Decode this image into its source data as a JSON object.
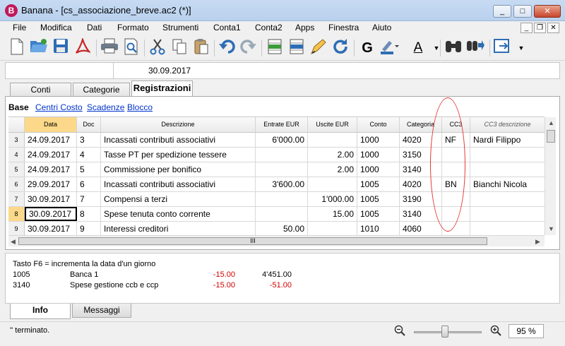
{
  "window": {
    "title": "Banana - [cs_associazione_breve.ac2 (*)]",
    "app_icon_glyph": "B",
    "btn_minimize": "_",
    "btn_maximize": "□",
    "btn_close": "✕"
  },
  "menu": [
    "File",
    "Modifica",
    "Dati",
    "Formato",
    "Strumenti",
    "Conta1",
    "Conta2",
    "Apps",
    "Finestra",
    "Aiuto"
  ],
  "mdi": {
    "minimize": "_",
    "restore": "❐",
    "close": "✕"
  },
  "toolbar": {
    "icons": [
      "new-file",
      "open-folder",
      "save",
      "pdf",
      "print",
      "print-preview",
      "cut",
      "copy",
      "paste",
      "undo",
      "redo",
      "insert-row",
      "delete-row",
      "check-accounting",
      "recheck",
      "bold",
      "highlight-color",
      "text-color",
      "find",
      "go-to",
      "move-window"
    ],
    "bold_label": "G",
    "text_color_label": "A"
  },
  "cellbar": {
    "value": "30.09.2017"
  },
  "tabs": [
    "Conti",
    "Categorie",
    "Registrazioni"
  ],
  "active_tab": "Registrazioni",
  "views": [
    "Base",
    "Centri Costo",
    "Scadenze",
    "Blocco"
  ],
  "grid": {
    "headers": [
      "Data",
      "Doc",
      "Descrizione",
      "Entrate EUR",
      "Uscite EUR",
      "Conto",
      "Categoria",
      "CC3",
      "CC3 descrizione"
    ],
    "rows": [
      {
        "row": "3",
        "date": "24.09.2017",
        "doc": "3",
        "desc": "Incassati contributi associativi",
        "in": "6'000.00",
        "out": "",
        "account": "1000",
        "category": "4020",
        "cc3": "NF",
        "cc3desc": "Nardi Filippo"
      },
      {
        "row": "4",
        "date": "24.09.2017",
        "doc": "4",
        "desc": "Tasse PT per spedizione tessere",
        "in": "",
        "out": "2.00",
        "account": "1000",
        "category": "3150",
        "cc3": "",
        "cc3desc": ""
      },
      {
        "row": "5",
        "date": "24.09.2017",
        "doc": "5",
        "desc": "Commissione per bonifico",
        "in": "",
        "out": "2.00",
        "account": "1000",
        "category": "3140",
        "cc3": "",
        "cc3desc": ""
      },
      {
        "row": "6",
        "date": "29.09.2017",
        "doc": "6",
        "desc": "Incassati contributi associativi",
        "in": "3'600.00",
        "out": "",
        "account": "1005",
        "category": "4020",
        "cc3": "BN",
        "cc3desc": "Bianchi Nicola"
      },
      {
        "row": "7",
        "date": "30.09.2017",
        "doc": "7",
        "desc": "Compensi a terzi",
        "in": "",
        "out": "1'000.00",
        "account": "1005",
        "category": "3190",
        "cc3": "",
        "cc3desc": ""
      },
      {
        "row": "8",
        "date": "30.09.2017",
        "doc": "8",
        "desc": "Spese tenuta conto corrente",
        "in": "",
        "out": "15.00",
        "account": "1005",
        "category": "3140",
        "cc3": "",
        "cc3desc": ""
      },
      {
        "row": "9",
        "date": "30.09.2017",
        "doc": "9",
        "desc": "Interessi creditori",
        "in": "50.00",
        "out": "",
        "account": "1010",
        "category": "4060",
        "cc3": "",
        "cc3desc": ""
      }
    ],
    "hscroll_grip": "III"
  },
  "info": {
    "hint": "Tasto F6 = incrementa la data d'un giorno",
    "lines": [
      {
        "code": "1005",
        "name": "Banca 1",
        "amount": "-15.00",
        "balance": "4'451.00"
      },
      {
        "code": "3140",
        "name": "Spese gestione ccb e ccp",
        "amount": "-15.00",
        "balance": "-51.00"
      }
    ]
  },
  "bottom_tabs": [
    "Info",
    "Messaggi"
  ],
  "status": {
    "text": "'' terminato.",
    "zoom": "95 %"
  }
}
